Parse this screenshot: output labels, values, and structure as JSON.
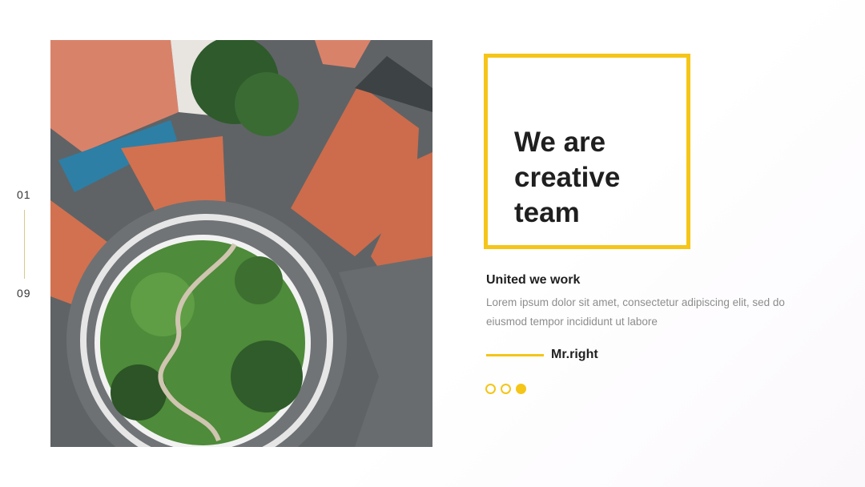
{
  "slide": {
    "page_current": "01",
    "page_total": "09",
    "title_lines": [
      "We are",
      "creative",
      "team"
    ],
    "subtitle": "United we work",
    "body": "Lorem ipsum dolor sit amet, consectetur adipiscing elit, sed do eiusmod tempor incididunt ut labore",
    "signature": "Mr.right",
    "pagination_dots": 3,
    "active_dot": 3
  },
  "colors": {
    "accent": "#f5c518",
    "heading": "#1f1f1f",
    "body": "#8d8d8d"
  }
}
